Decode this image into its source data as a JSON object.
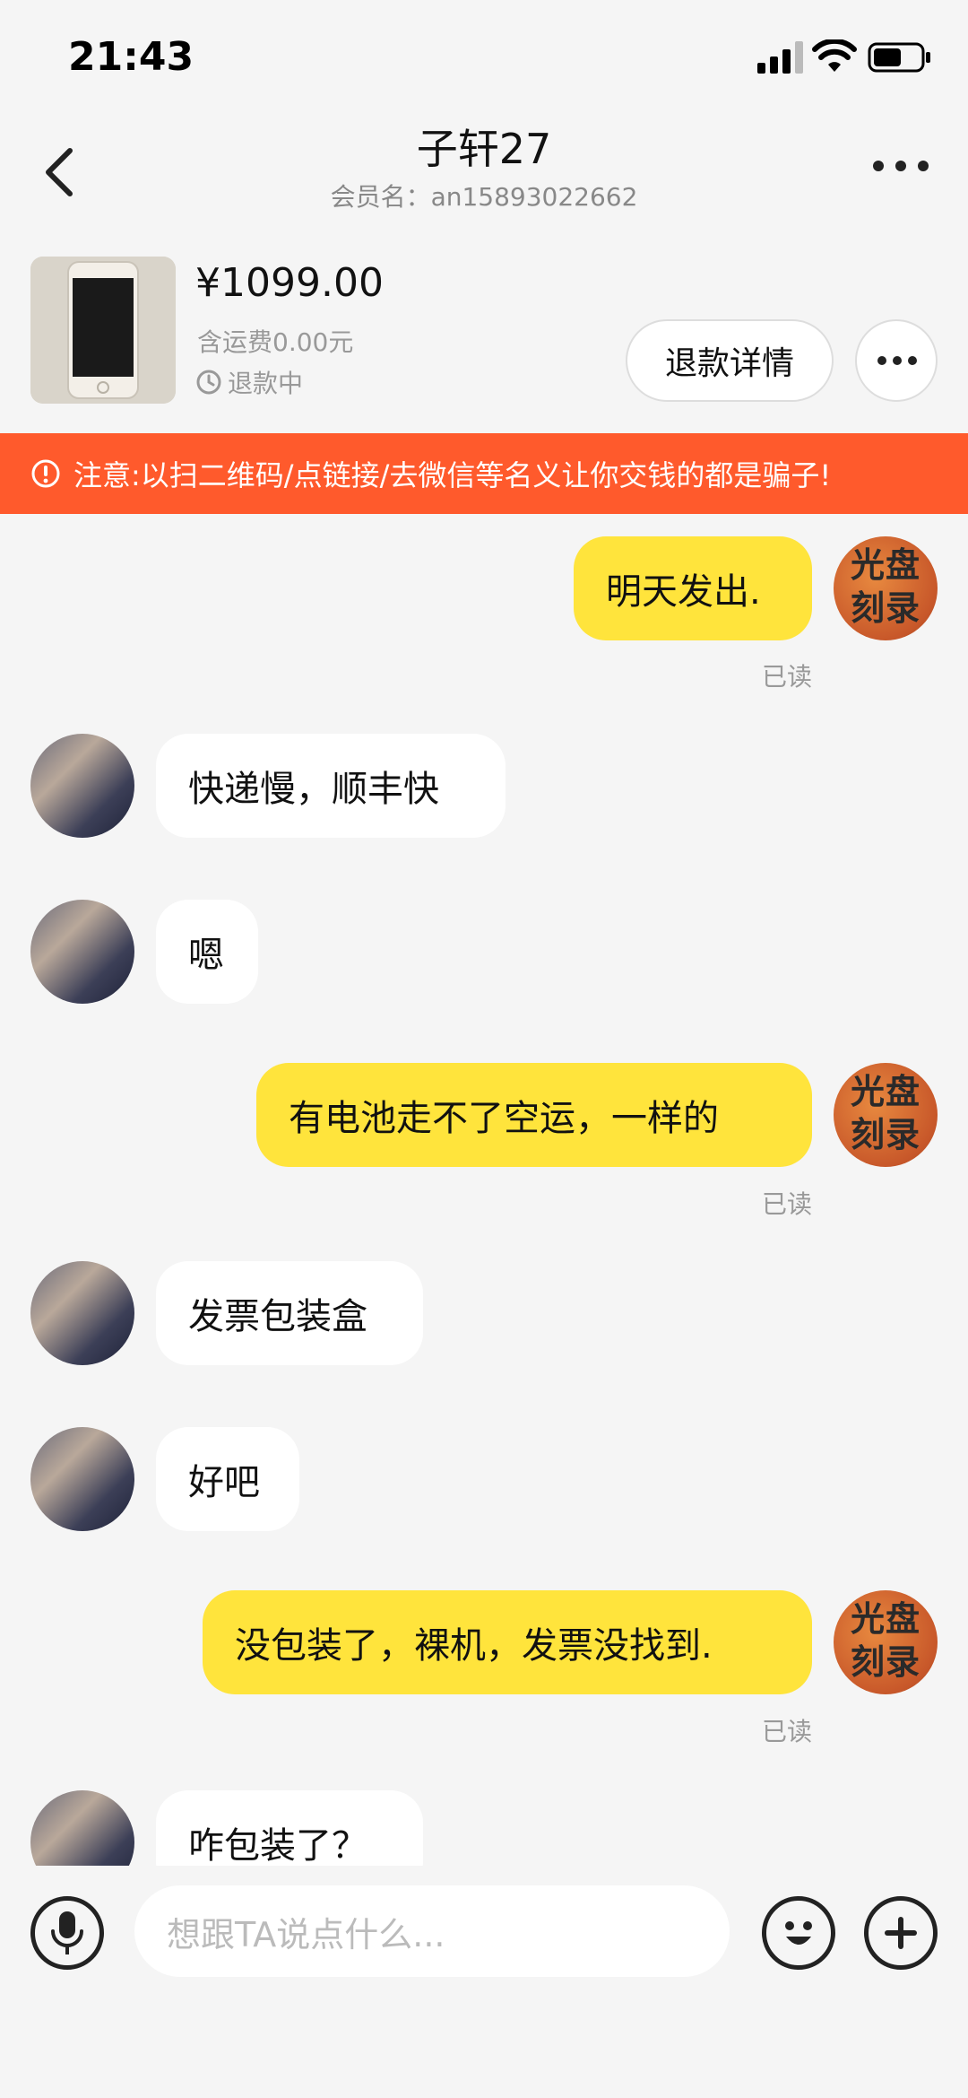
{
  "status_bar": {
    "time": "21:43"
  },
  "nav": {
    "title": "子轩27",
    "subtitle": "会员名：an15893022662"
  },
  "product": {
    "price": "¥1099.00",
    "shipping": "含运费0.00元",
    "status": "退款中",
    "refund_button": "退款详情"
  },
  "warning": {
    "text": "注意:以扫二维码/点链接/去微信等名义让你交钱的都是骗子!"
  },
  "avatar_self_text": "光盘刻录",
  "messages": [
    {
      "from": "self",
      "text": "明天发出.",
      "read": "已读"
    },
    {
      "from": "peer",
      "text": "快递慢，顺丰快"
    },
    {
      "from": "peer",
      "text": "嗯"
    },
    {
      "from": "self",
      "text": "有电池走不了空运，一样的",
      "read": "已读"
    },
    {
      "from": "peer",
      "text": "发票包装盒"
    },
    {
      "from": "peer",
      "text": "好吧"
    },
    {
      "from": "self",
      "text": "没包装了，裸机，发票没找到.",
      "read": "已读"
    },
    {
      "from": "peer",
      "text": "咋包装了？"
    }
  ],
  "input": {
    "placeholder": "想跟TA说点什么..."
  },
  "colors": {
    "accent_bubble": "#ffe43c",
    "warning": "#ff5a2c"
  }
}
